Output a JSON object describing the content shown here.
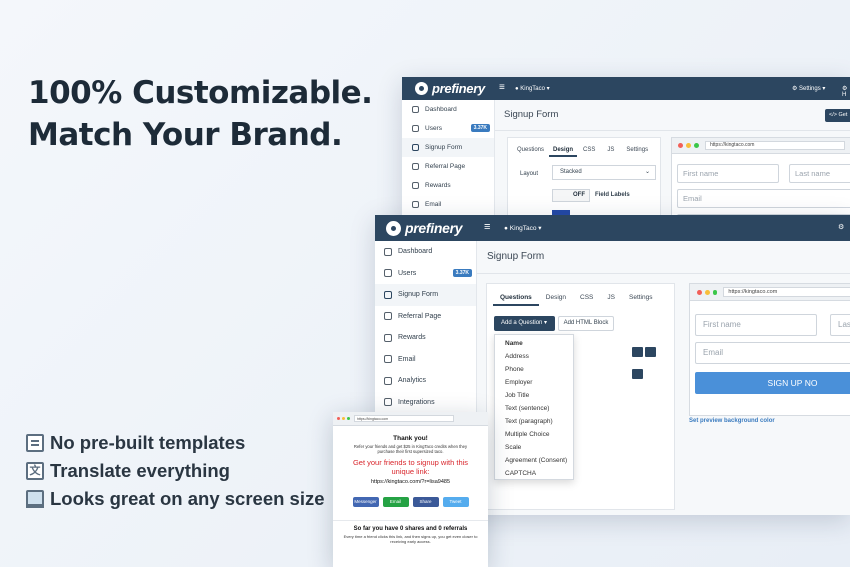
{
  "headline": {
    "line1": "100% Customizable.",
    "line2": "Match Your Brand."
  },
  "features": [
    {
      "text": "No pre-built templates",
      "icon": "document-icon"
    },
    {
      "text": "Translate everything",
      "icon": "translate-icon"
    },
    {
      "text": "Looks great on any screen size",
      "icon": "laptop-icon"
    }
  ],
  "app": {
    "logo": "prefinery",
    "menu_glyph": "≡",
    "account": "KingTaco",
    "settings": "Settings",
    "page_title": "Signup Form",
    "get_button": "Get",
    "users_badge": "3.37K",
    "sidebar": [
      "Dashboard",
      "Users",
      "Signup Form",
      "Referral Page",
      "Rewards",
      "Email",
      "Analytics",
      "Integrations"
    ],
    "tabs": [
      "Questions",
      "Design",
      "CSS",
      "JS",
      "Settings"
    ],
    "layout_label": "Layout",
    "layout_value": "Stacked",
    "toggle_off": "OFF",
    "field_labels": "Field Labels",
    "add_question": "Add a Question",
    "add_html_block": "Add HTML Block",
    "question_options": [
      "Name",
      "Address",
      "Phone",
      "Employer",
      "Job Title",
      "Text (sentence)",
      "Text (paragraph)",
      "Multiple Choice",
      "Scale",
      "Agreement (Consent)",
      "CAPTCHA"
    ],
    "preview_link": "Set preview background color"
  },
  "preview": {
    "url": "https://kingtaco.com",
    "first_name": "First name",
    "last_name": "Last name",
    "last_short": "Las",
    "email": "Email",
    "signup_button": "SIGN UP NOW",
    "signup_short": "SIGN UP NO"
  },
  "mobile": {
    "url": "https://kingtaco.com",
    "thank_you": "Thank you!",
    "intro": "Refer your friends and get $25 in KingTaco credits when they purchase their first supersized taco.",
    "cta": "Get your friends to signup with this unique link:",
    "link": "https://kingtaco.com/?r=lisa9485",
    "share_buttons": [
      "Messenger",
      "Email",
      "Share",
      "Tweet"
    ],
    "share_colors": [
      "#4267b2",
      "#25a244",
      "#3b5998",
      "#55acee"
    ],
    "so_far": "So far you have 0 shares and 0 referrals",
    "footer": "Every time a friend clicks this link, and then signs up, you get even closer to receiving early access."
  },
  "colors": {
    "topbar": "#2c4660",
    "accent": "#3a7bbf",
    "signup_button": "#4a90d9",
    "cta": "#d9262c"
  }
}
